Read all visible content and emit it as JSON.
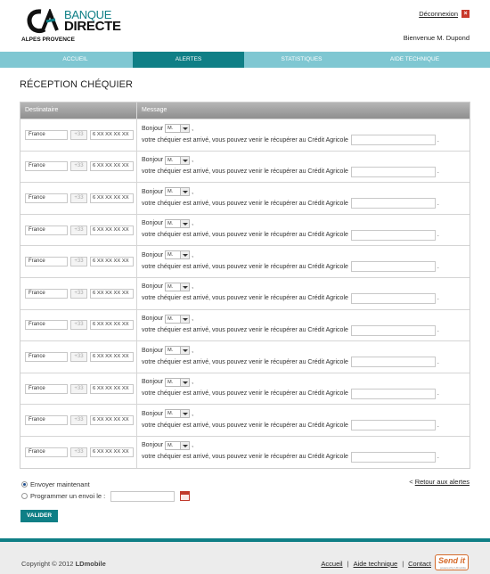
{
  "header": {
    "brand_line1": "BANQUE",
    "brand_line2": "DIRECTE",
    "region": "ALPES PROVENCE",
    "logout_label": "Déconnexion",
    "welcome": "Bienvenue M. Dupond"
  },
  "nav": [
    "ACCUEIL",
    "ALERTES",
    "STATISTIQUES",
    "AIDE TECHNIQUE"
  ],
  "nav_active_index": 1,
  "page_title": "RÉCEPTION CHÉQUIER",
  "table": {
    "headers": [
      "Destinataire",
      "Message"
    ],
    "rows": [
      {
        "country": "France",
        "prefix": "+33",
        "phone": "6 XX XX XX XX",
        "greeting": "Bonjour",
        "civility": "M.",
        "comma": ",",
        "message": "votre chéquier est arrivé, vous pouvez venir le récupérer au Crédit Agricole",
        "agency": "",
        "period": "."
      },
      {
        "country": "France",
        "prefix": "+33",
        "phone": "6 XX XX XX XX",
        "greeting": "Bonjour",
        "civility": "M.",
        "comma": ",",
        "message": "votre chéquier est arrivé, vous pouvez venir le récupérer au Crédit Agricole",
        "agency": "",
        "period": "."
      },
      {
        "country": "France",
        "prefix": "+33",
        "phone": "6 XX XX XX XX",
        "greeting": "Bonjour",
        "civility": "M.",
        "comma": ",",
        "message": "votre chéquier est arrivé, vous pouvez venir le récupérer au Crédit Agricole",
        "agency": "",
        "period": "."
      },
      {
        "country": "France",
        "prefix": "+33",
        "phone": "6 XX XX XX XX",
        "greeting": "Bonjour",
        "civility": "M.",
        "comma": ",",
        "message": "votre chéquier est arrivé, vous pouvez venir le récupérer au Crédit Agricole",
        "agency": "",
        "period": "."
      },
      {
        "country": "France",
        "prefix": "+33",
        "phone": "6 XX XX XX XX",
        "greeting": "Bonjour",
        "civility": "M.",
        "comma": ",",
        "message": "votre chéquier est arrivé, vous pouvez venir le récupérer au Crédit Agricole",
        "agency": "",
        "period": "."
      },
      {
        "country": "France",
        "prefix": "+33",
        "phone": "6 XX XX XX XX",
        "greeting": "Bonjour",
        "civility": "M.",
        "comma": ",",
        "message": "votre chéquier est arrivé, vous pouvez venir le récupérer au Crédit Agricole",
        "agency": "",
        "period": "."
      },
      {
        "country": "France",
        "prefix": "+33",
        "phone": "6 XX XX XX XX",
        "greeting": "Bonjour",
        "civility": "M.",
        "comma": ",",
        "message": "votre chéquier est arrivé, vous pouvez venir le récupérer au Crédit Agricole",
        "agency": "",
        "period": "."
      },
      {
        "country": "France",
        "prefix": "+33",
        "phone": "6 XX XX XX XX",
        "greeting": "Bonjour",
        "civility": "M.",
        "comma": ",",
        "message": "votre chéquier est arrivé, vous pouvez venir le récupérer au Crédit Agricole",
        "agency": "",
        "period": "."
      },
      {
        "country": "France",
        "prefix": "+33",
        "phone": "6 XX XX XX XX",
        "greeting": "Bonjour",
        "civility": "M.",
        "comma": ",",
        "message": "votre chéquier est arrivé, vous pouvez venir le récupérer au Crédit Agricole",
        "agency": "",
        "period": "."
      },
      {
        "country": "France",
        "prefix": "+33",
        "phone": "6 XX XX XX XX",
        "greeting": "Bonjour",
        "civility": "M.",
        "comma": ",",
        "message": "votre chéquier est arrivé, vous pouvez venir le récupérer au Crédit Agricole",
        "agency": "",
        "period": "."
      },
      {
        "country": "France",
        "prefix": "+33",
        "phone": "6 XX XX XX XX",
        "greeting": "Bonjour",
        "civility": "M.",
        "comma": ",",
        "message": "votre chéquier est arrivé, vous pouvez venir le récupérer au Crédit Agricole",
        "agency": "",
        "period": "."
      }
    ]
  },
  "send_options": {
    "now_label": "Envoyer maintenant",
    "schedule_label": "Programmer un envoi le :",
    "schedule_date": "",
    "selected": "now"
  },
  "back_prefix": "<",
  "back_link": "Retour aux alertes",
  "validate_label": "VALIDER",
  "footer": {
    "copyright_prefix": "Copyright © 2012",
    "copyright_brand": "LDmobile",
    "links": [
      "Accueil",
      "Aide technique",
      "Contact"
    ],
    "separator": "|",
    "partner_logo": "Send it",
    "partner_tagline": "powered by LDmobile"
  },
  "colors": {
    "teal_dark": "#0f7f86",
    "teal_light": "#7fc7d2",
    "logout_red": "#c8392b",
    "partner_orange": "#d56a2a"
  },
  "icons": [
    "ca-logo-icon",
    "close-icon",
    "chevron-down-icon",
    "calendar-icon",
    "radio-icon"
  ]
}
